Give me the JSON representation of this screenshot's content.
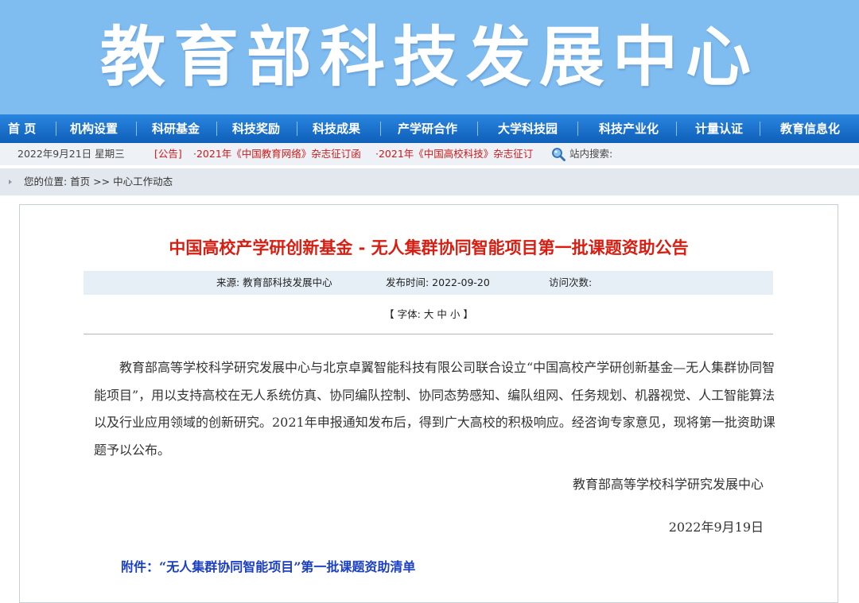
{
  "site": {
    "title": "教育部科技发展中心"
  },
  "nav": {
    "items": [
      "首 页",
      "机构设置",
      "科研基金",
      "科技奖励",
      "科技成果",
      "产学研合作",
      "大学科技园",
      "科技产业化",
      "计量认证",
      "教育信息化"
    ]
  },
  "info_bar": {
    "date": "2022年9月21日 星期三",
    "notice_tag": "[公告]",
    "notices": [
      "·2021年《中国教育网络》杂志征订函",
      "·2021年《中国高校科技》杂志征订"
    ],
    "search_label": "站内搜索:"
  },
  "breadcrumb": {
    "text": "您的位置: 首页 >> 中心工作动态"
  },
  "article": {
    "title": "中国高校产学研创新基金 - 无人集群协同智能项目第一批课题资助公告",
    "source": "来源:  教育部科技发展中心",
    "publish": "发布时间:  2022-09-20",
    "visits": "访问次数:",
    "font_prefix": "【 字体: ",
    "font_sizes": [
      "大",
      "中",
      "小"
    ],
    "font_suffix": " 】",
    "body": "教育部高等学校科学研究发展中心与北京卓翼智能科技有限公司联合设立“中国高校产学研创新基金—无人集群协同智能项目”，用以支持高校在无人系统仿真、协同编队控制、协同态势感知、编队组网、任务规划、机器视觉、人工智能算法以及行业应用领域的创新研究。2021年申报通知发布后，得到广大高校的积极响应。经咨询专家意见，现将第一批资助课题予以公布。",
    "sign_org": "教育部高等学校科学研究发展中心",
    "sign_date": "2022年9月19日",
    "attachment": "附件：“无人集群协同智能项目”第一批课题资助清单"
  }
}
